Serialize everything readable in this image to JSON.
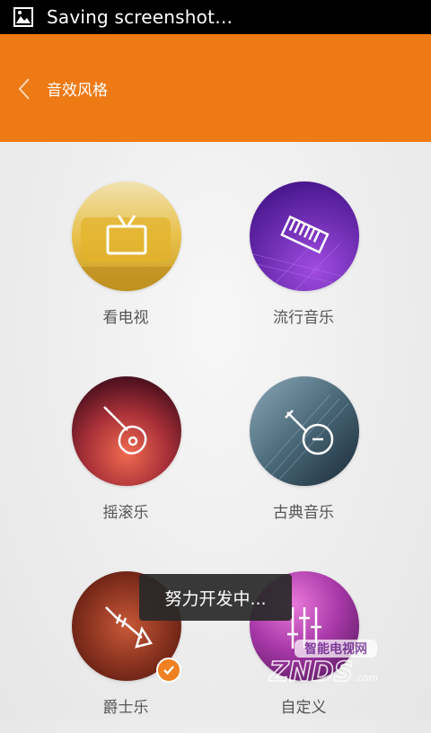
{
  "status_bar": {
    "text": "Saving screenshot…",
    "icon": "image-icon"
  },
  "header": {
    "title": "音效风格",
    "back_icon": "chevron-left-icon",
    "color": "#ee7a16"
  },
  "styles": [
    {
      "label": "看电视",
      "icon": "tv-icon",
      "selected": false
    },
    {
      "label": "流行音乐",
      "icon": "keyboard-icon",
      "selected": false
    },
    {
      "label": "摇滚乐",
      "icon": "guitar-icon",
      "selected": false
    },
    {
      "label": "古典音乐",
      "icon": "pipa-icon",
      "selected": false
    },
    {
      "label": "爵士乐",
      "icon": "trumpet-icon",
      "selected": true
    },
    {
      "label": "自定义",
      "icon": "equalizer-icon",
      "selected": false
    }
  ],
  "toast": {
    "text": "努力开发中..."
  },
  "watermark": {
    "text_cn": "智能电视网",
    "text_en": "ZNDS",
    "domain": ".com"
  }
}
